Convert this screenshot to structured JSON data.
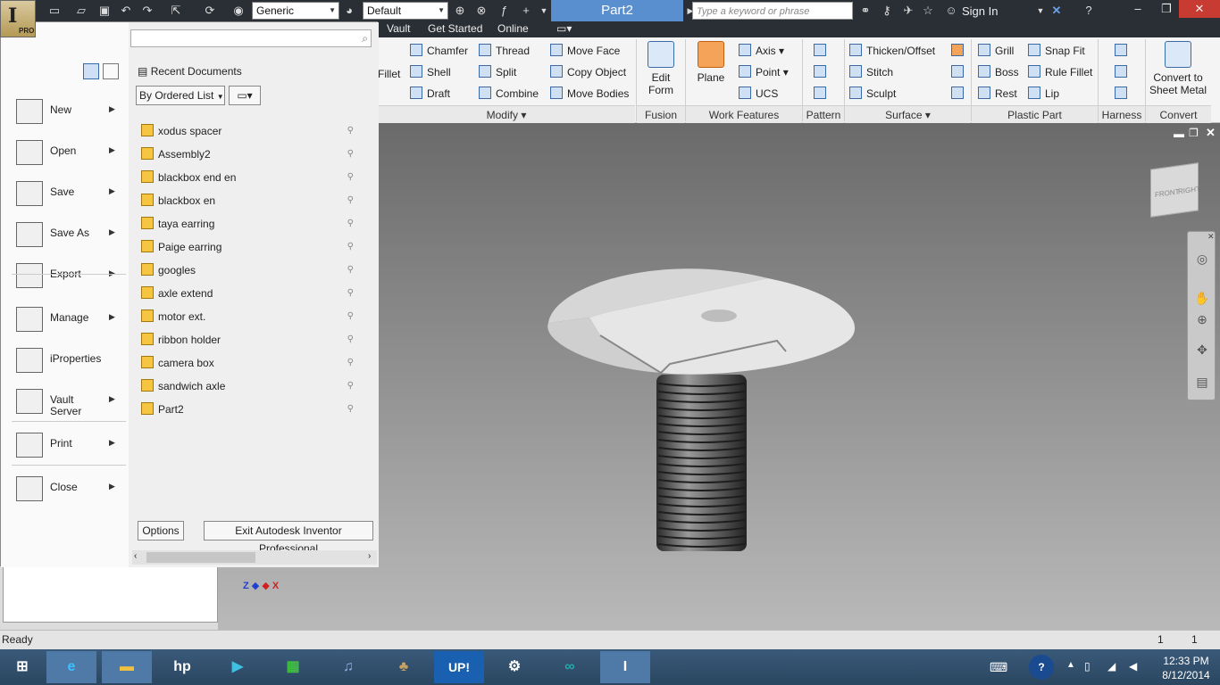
{
  "app": {
    "logo": "I",
    "badge": "PRO",
    "document_title": "Part2"
  },
  "quick_access": {
    "material": "Generic",
    "appearance": "Default"
  },
  "search": {
    "placeholder": "Type a keyword or phrase"
  },
  "account": {
    "sign_in": "Sign In"
  },
  "tabs": [
    "Vault",
    "Get Started",
    "Online"
  ],
  "ribbon": {
    "modify": {
      "fillet": "Fillet",
      "chamfer": "Chamfer",
      "shell": "Shell",
      "draft": "Draft",
      "thread": "Thread",
      "split": "Split",
      "combine": "Combine",
      "move_face": "Move Face",
      "copy_object": "Copy Object",
      "move_bodies": "Move Bodies",
      "label": "Modify"
    },
    "fusion": {
      "edit_form": "Edit\nForm",
      "label": "Fusion"
    },
    "work_features": {
      "plane": "Plane",
      "axis": "Axis",
      "point": "Point",
      "ucs": "UCS",
      "label": "Work Features"
    },
    "pattern": {
      "label": "Pattern"
    },
    "surface": {
      "thicken": "Thicken/Offset",
      "stitch": "Stitch",
      "sculpt": "Sculpt",
      "label": "Surface"
    },
    "plastic_part": {
      "grill": "Grill",
      "boss": "Boss",
      "rest": "Rest",
      "snap_fit": "Snap Fit",
      "rule_fillet": "Rule Fillet",
      "lip": "Lip",
      "label": "Plastic Part"
    },
    "harness": {
      "label": "Harness"
    },
    "convert": {
      "sheet_metal": "Convert to\nSheet Metal",
      "label": "Convert"
    }
  },
  "app_menu": {
    "items": [
      {
        "label": "New",
        "icon": "new-document-icon"
      },
      {
        "label": "Open",
        "icon": "open-folder-icon"
      },
      {
        "label": "Save",
        "icon": "save-icon"
      },
      {
        "label": "Save As",
        "icon": "save-as-icon"
      },
      {
        "label": "Export",
        "icon": "export-icon"
      },
      {
        "label": "Manage",
        "icon": "manage-icon"
      },
      {
        "label": "iProperties",
        "icon": "iproperties-icon"
      },
      {
        "label": "Vault\nServer",
        "icon": "vault-icon"
      },
      {
        "label": "Print",
        "icon": "print-icon"
      },
      {
        "label": "Close",
        "icon": "close-document-icon"
      }
    ],
    "recent_title": "Recent Documents",
    "sort": "By Ordered List",
    "recent": [
      "xodus spacer",
      "Assembly2",
      "blackbox end en",
      "blackbox en",
      "taya earring",
      "Paige earring",
      "googles",
      "axle extend",
      "motor ext.",
      "ribbon holder",
      "camera box",
      "sandwich axle",
      "Part2"
    ],
    "options_button": "Options",
    "exit_button": "Exit Autodesk Inventor Professional"
  },
  "viewcube": {
    "front": "FRONT",
    "right": "RIGHT"
  },
  "status": {
    "text": "Ready",
    "count_a": "1",
    "count_b": "1"
  },
  "axis_labels": {
    "z": "Z",
    "x": "X"
  },
  "taskbar": {
    "up_label": "UP!"
  },
  "clock": {
    "time": "12:33 PM",
    "date": "8/12/2014"
  }
}
